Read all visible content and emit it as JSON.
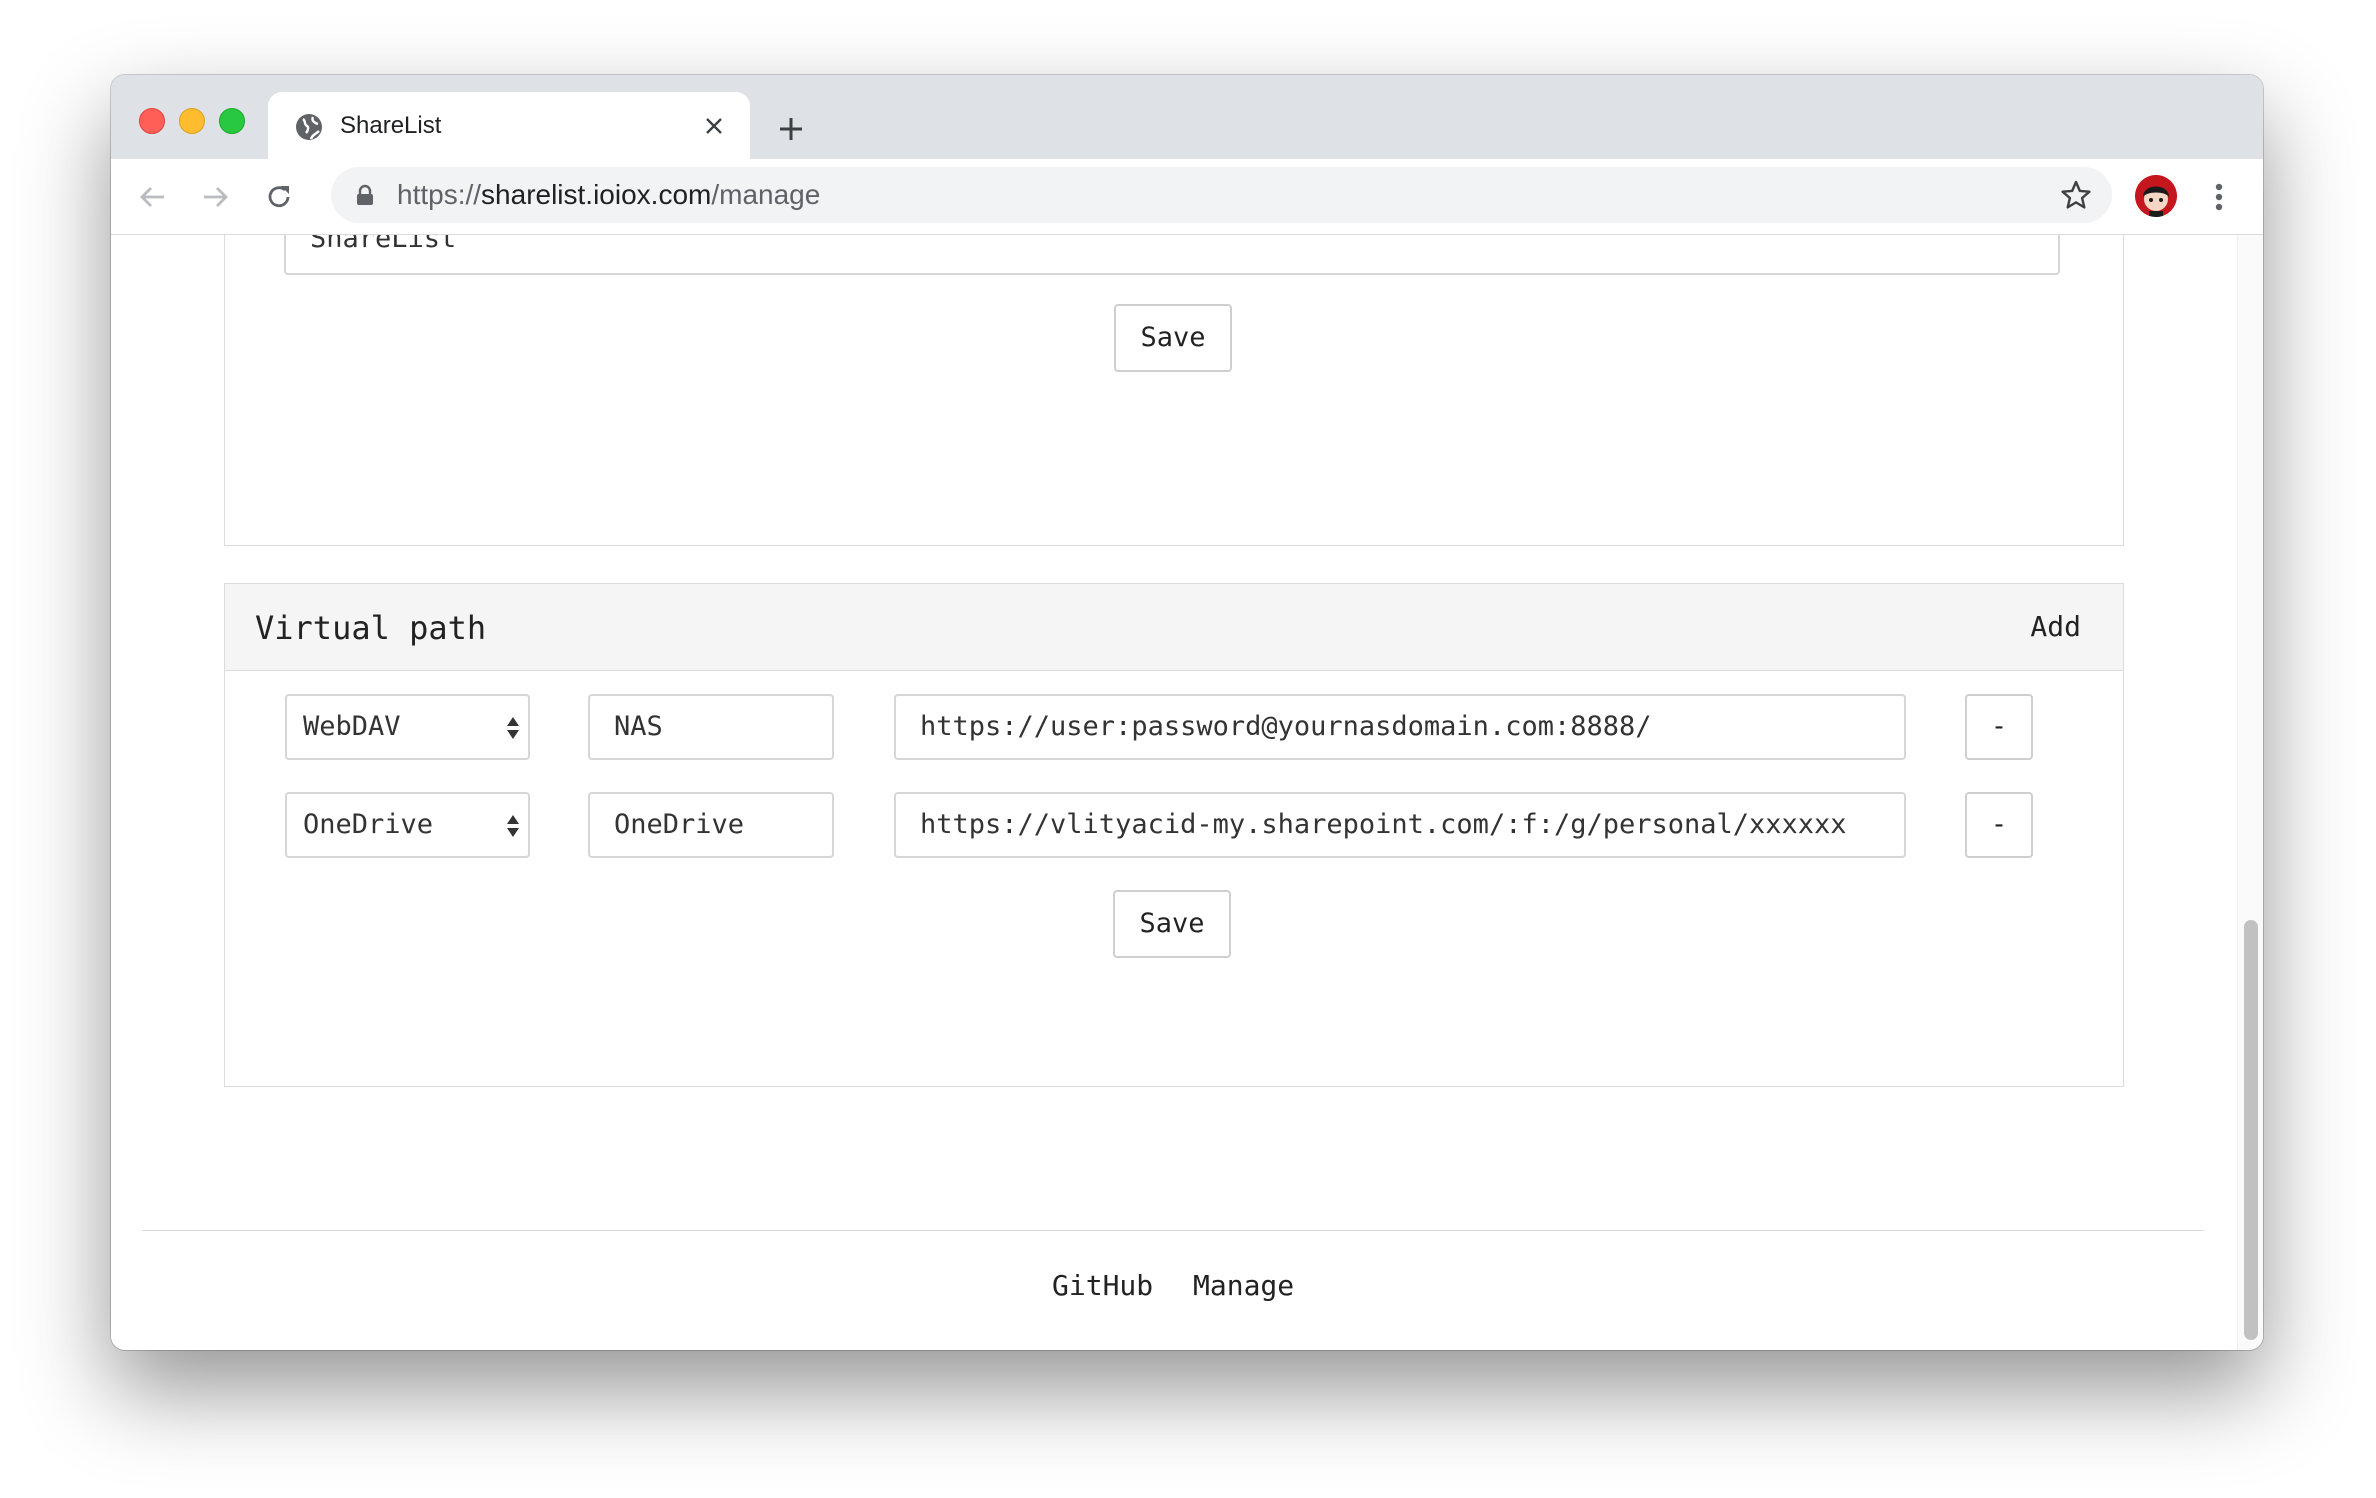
{
  "browser": {
    "tab_title": "ShareList",
    "url_scheme": "https://",
    "url_host": "sharelist.ioiox.com",
    "url_path": "/manage"
  },
  "site_title_card": {
    "title_value": "ShareList",
    "save_label": "Save"
  },
  "virtual_path": {
    "heading": "Virtual path",
    "add_label": "Add",
    "rows": [
      {
        "type": "WebDAV",
        "name": "NAS",
        "path": "https://user:password@yournasdomain.com:8888/",
        "remove_label": "-"
      },
      {
        "type": "OneDrive",
        "name": "OneDrive",
        "path": "https://vlityacid-my.sharepoint.com/:f:/g/personal/xxxxxx",
        "remove_label": "-"
      }
    ],
    "save_label": "Save"
  },
  "footer": {
    "links": [
      "GitHub",
      "Manage"
    ]
  },
  "colors": {
    "tabstrip_bg": "#dee1e6",
    "omnibox_bg": "#f1f3f4",
    "card_header_bg": "#f5f5f5",
    "traffic_red": "#ff5f57",
    "traffic_yellow": "#febc2e",
    "traffic_green": "#28c840"
  },
  "icons": [
    "globe-icon",
    "close-icon",
    "plus-icon",
    "back-arrow-icon",
    "forward-arrow-icon",
    "reload-icon",
    "lock-icon",
    "star-icon",
    "avatar",
    "kebab-menu-icon",
    "select-arrows-icon"
  ]
}
